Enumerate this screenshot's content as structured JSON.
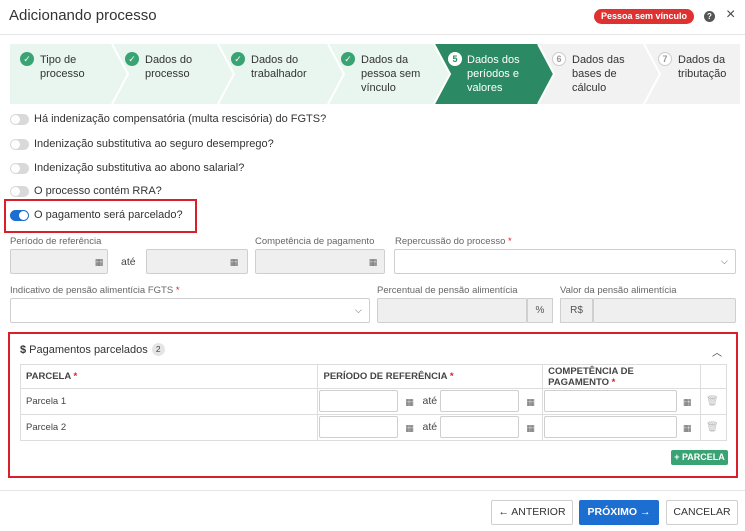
{
  "header": {
    "title": "Adicionando processo",
    "badge": "Pessoa sem vínculo",
    "help": "?",
    "close": "×"
  },
  "stepper": {
    "steps": [
      {
        "num": "✓",
        "line1": "Tipo de",
        "line2": "processo",
        "line3": "",
        "state": "done"
      },
      {
        "num": "✓",
        "line1": "Dados do",
        "line2": "processo",
        "line3": "",
        "state": "done"
      },
      {
        "num": "✓",
        "line1": "Dados do",
        "line2": "trabalhador",
        "line3": "",
        "state": "done"
      },
      {
        "num": "✓",
        "line1": "Dados da",
        "line2": "pessoa sem",
        "line3": "vínculo",
        "state": "done"
      },
      {
        "num": "5",
        "line1": "Dados dos",
        "line2": "períodos e",
        "line3": "valores",
        "state": "active"
      },
      {
        "num": "6",
        "line1": "Dados das",
        "line2": "bases de",
        "line3": "cálculo",
        "state": "todo"
      },
      {
        "num": "7",
        "line1": "Dados da",
        "line2": "tributação",
        "line3": "",
        "state": "todo"
      }
    ]
  },
  "toggles": [
    {
      "label": "Há indenização compensatória (multa rescisória) do FGTS?",
      "on": false
    },
    {
      "label": "Indenização substitutiva ao seguro desemprego?",
      "on": false
    },
    {
      "label": "Indenização substitutiva ao abono salarial?",
      "on": false
    },
    {
      "label": "O processo contém RRA?",
      "on": false
    },
    {
      "label": "O pagamento será parcelado?",
      "on": true
    }
  ],
  "form": {
    "periodo_label": "Período de referência",
    "ate": "até",
    "competencia_label": "Competência de pagamento",
    "repercussao_label": "Repercussão do processo",
    "indicativo_label": "Indicativo de pensão alimentícia FGTS",
    "percentual_label": "Percentual de pensão alimentícia",
    "percent_symbol": "%",
    "valor_label": "Valor da pensão alimentícia",
    "currency": "R$",
    "required_mark": "*"
  },
  "parcelas": {
    "title": "Pagamentos parcelados",
    "dollar": "$",
    "count": "2",
    "columns": [
      "PARCELA",
      "PERÍODO DE REFERÊNCIA",
      "COMPETÊNCIA DE PAGAMENTO"
    ],
    "rows": [
      {
        "name": "Parcela 1"
      },
      {
        "name": "Parcela 2"
      }
    ],
    "add_button": "+ PARCELA"
  },
  "footer": {
    "anterior": "← ANTERIOR",
    "proximo": "PRÓXIMO →",
    "cancelar": "CANCELAR"
  },
  "colors": {
    "active_step": "#2b8a63",
    "done_step_bg": "#e8f6ef",
    "primary": "#1c6fd1",
    "highlight": "#d9202a",
    "success": "#3aa374"
  }
}
